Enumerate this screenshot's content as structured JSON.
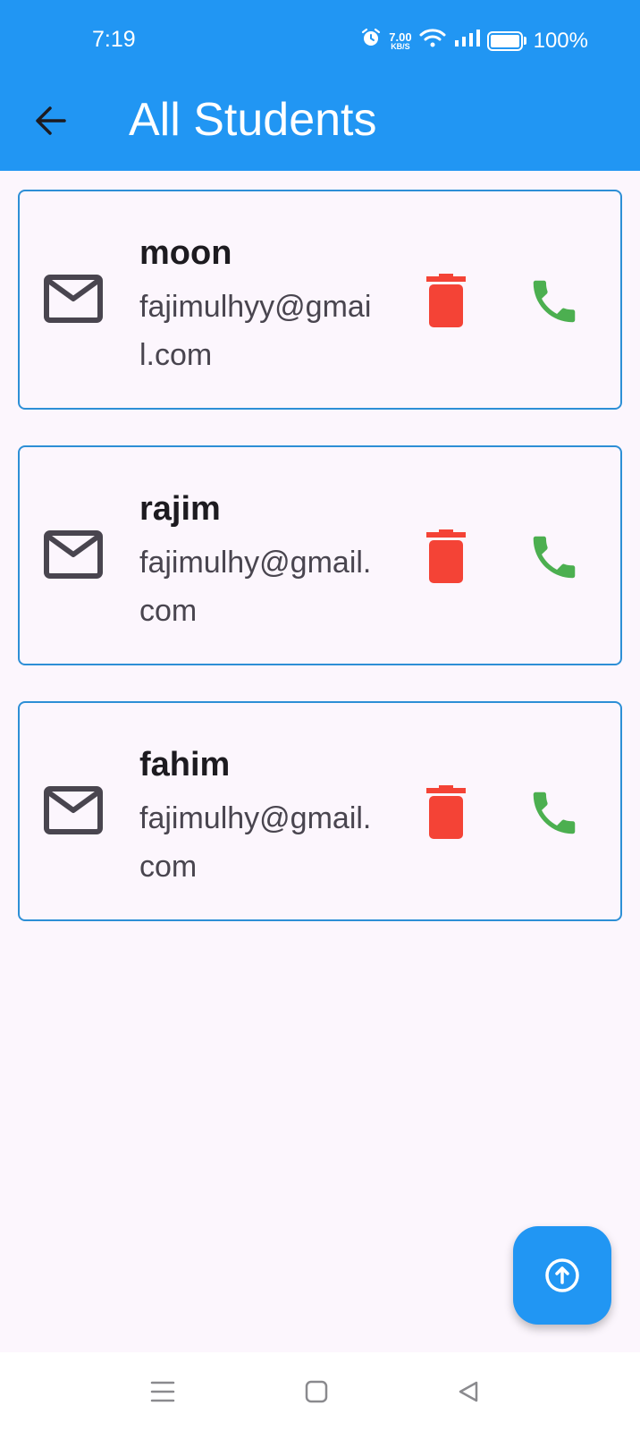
{
  "status_bar": {
    "time": "7:19",
    "net_speed_value": "7.00",
    "net_speed_unit": "KB/S",
    "battery": "100%",
    "icons": [
      "alarm-icon",
      "wifi-icon",
      "signal-icon",
      "battery-icon"
    ]
  },
  "app_bar": {
    "title": "All Students",
    "back_icon": "arrow-back-icon",
    "color": "#2196f3"
  },
  "students": [
    {
      "name": "moon",
      "email": "fajimulhyy@gmail.com"
    },
    {
      "name": "rajim",
      "email": "fajimulhy@gmail.com"
    },
    {
      "name": "fahim",
      "email": "fajimulhy@gmail.com"
    }
  ],
  "card_actions": {
    "leading_icon": "mail-icon",
    "delete_icon": "delete-icon",
    "call_icon": "phone-icon",
    "delete_color": "#f44336",
    "call_color": "#4caf50"
  },
  "fab": {
    "icon": "upload-icon",
    "color": "#2196f3"
  },
  "nav_bar": {
    "icons": [
      "menu-icon",
      "home-icon",
      "back-icon"
    ]
  }
}
